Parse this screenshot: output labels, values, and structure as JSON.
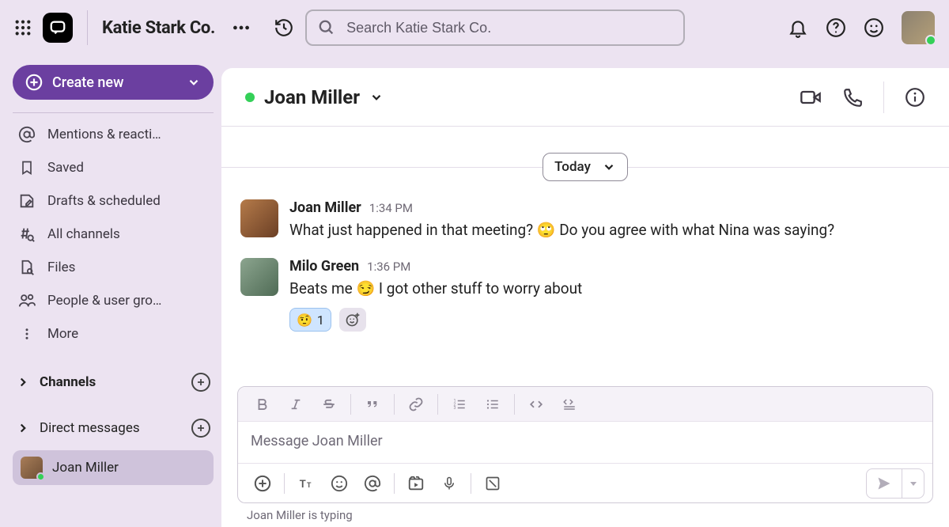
{
  "workspace": {
    "name": "Katie Stark Co."
  },
  "search": {
    "placeholder": "Search Katie Stark Co."
  },
  "create_button": {
    "label": "Create new"
  },
  "nav": {
    "items": [
      {
        "icon": "at",
        "label": "Mentions & reacti…"
      },
      {
        "icon": "bookmark",
        "label": "Saved"
      },
      {
        "icon": "draft",
        "label": "Drafts & scheduled"
      },
      {
        "icon": "hash",
        "label": "All channels"
      },
      {
        "icon": "file",
        "label": "Files"
      },
      {
        "icon": "people",
        "label": "People & user gro…"
      },
      {
        "icon": "more",
        "label": "More"
      }
    ]
  },
  "sections": {
    "channels": {
      "label": "Channels"
    },
    "dms": {
      "label": "Direct messages"
    }
  },
  "dm_active": {
    "name": "Joan Miller"
  },
  "chat_header": {
    "name": "Joan Miller"
  },
  "date_divider": {
    "label": "Today"
  },
  "messages": [
    {
      "author": "Joan Miller",
      "time": "1:34 PM",
      "pre": "What just happened in that meeting? ",
      "emoji": "🙄",
      "post": " Do you agree with what Nina was saying?"
    },
    {
      "author": "Milo Green",
      "time": "1:36 PM",
      "pre": "Beats me ",
      "emoji": "😏",
      "post": " I got other stuff to worry about",
      "reaction": {
        "emoji": "🤨",
        "count": "1"
      }
    }
  ],
  "composer": {
    "placeholder": "Message Joan Miller"
  },
  "typing": {
    "text": "Joan Miller is typing"
  }
}
